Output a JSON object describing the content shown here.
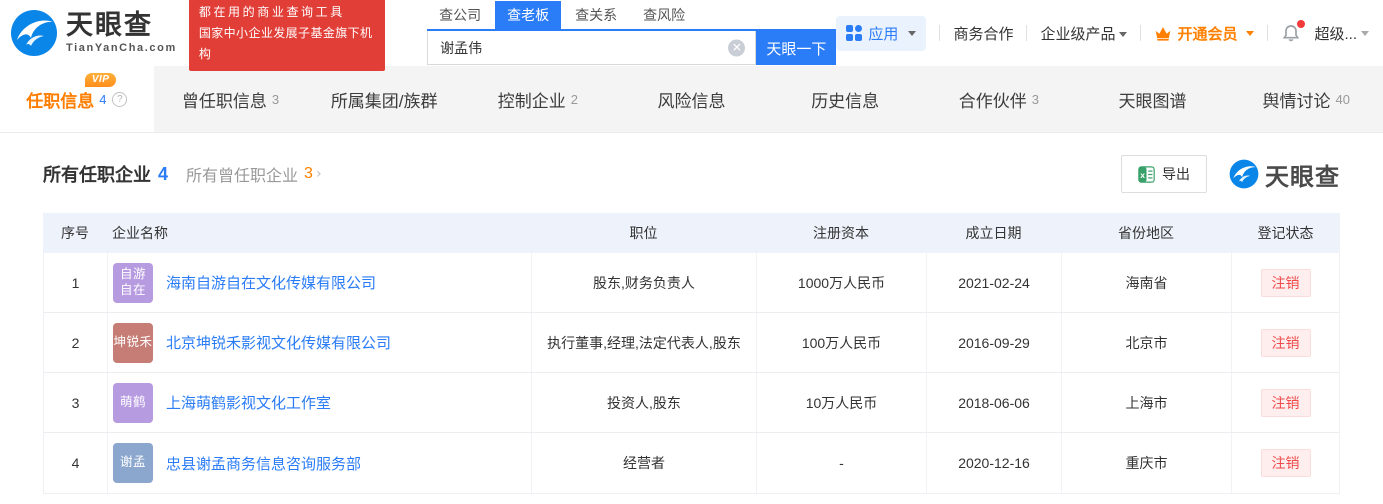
{
  "header": {
    "logo": {
      "title": "天眼查",
      "subtitle": "TianYanCha.com"
    },
    "promo": {
      "line1": "都在用的商业查询工具",
      "line2": "国家中小企业发展子基金旗下机构"
    },
    "search": {
      "tabs": [
        {
          "label": "查公司",
          "active": false
        },
        {
          "label": "查老板",
          "active": true
        },
        {
          "label": "查关系",
          "active": false
        },
        {
          "label": "查风险",
          "active": false
        }
      ],
      "value": "谢孟伟",
      "button": "天眼一下"
    },
    "nav": {
      "apps": "应用",
      "coop": "商务合作",
      "products": "企业级产品",
      "vip": "开通会员",
      "user": "超级..."
    }
  },
  "tabs": [
    {
      "label": "任职信息",
      "count": "4",
      "active": true,
      "vip": true,
      "help": true
    },
    {
      "label": "曾任职信息",
      "count": "3"
    },
    {
      "label": "所属集团/族群",
      "count": ""
    },
    {
      "label": "控制企业",
      "count": "2"
    },
    {
      "label": "风险信息",
      "count": ""
    },
    {
      "label": "历史信息",
      "count": ""
    },
    {
      "label": "合作伙伴",
      "count": "3"
    },
    {
      "label": "天眼图谱",
      "count": ""
    },
    {
      "label": "舆情讨论",
      "count": "40"
    }
  ],
  "section": {
    "title": "所有任职企业",
    "title_count": "4",
    "secondary": "所有曾任职企业",
    "secondary_count": "3",
    "chevron": "〉",
    "export_label": "导出",
    "watermark": "天眼查"
  },
  "table": {
    "headers": [
      "序号",
      "企业名称",
      "职位",
      "注册资本",
      "成立日期",
      "省份地区",
      "登记状态"
    ],
    "rows": [
      {
        "index": "1",
        "icon_lines": [
          "自游",
          "自在"
        ],
        "icon_color": "#b79be1",
        "company": "海南自游自在文化传媒有限公司",
        "position": "股东,财务负责人",
        "capital": "1000万人民币",
        "date": "2021-02-24",
        "region": "海南省",
        "status": "注销"
      },
      {
        "index": "2",
        "icon_lines": [
          "坤锐禾"
        ],
        "icon_color": "#c57d76",
        "company": "北京坤锐禾影视文化传媒有限公司",
        "position": "执行董事,经理,法定代表人,股东",
        "capital": "100万人民币",
        "date": "2016-09-29",
        "region": "北京市",
        "status": "注销"
      },
      {
        "index": "3",
        "icon_lines": [
          "萌鹤"
        ],
        "icon_color": "#b79be1",
        "company": "上海萌鹤影视文化工作室",
        "position": "投资人,股东",
        "capital": "10万人民币",
        "date": "2018-06-06",
        "region": "上海市",
        "status": "注销"
      },
      {
        "index": "4",
        "icon_lines": [
          "谢孟"
        ],
        "icon_color": "#8ca7cd",
        "company": "忠县谢孟商务信息咨询服务部",
        "position": "经营者",
        "capital": "-",
        "date": "2020-12-16",
        "region": "重庆市",
        "status": "注销"
      }
    ]
  }
}
